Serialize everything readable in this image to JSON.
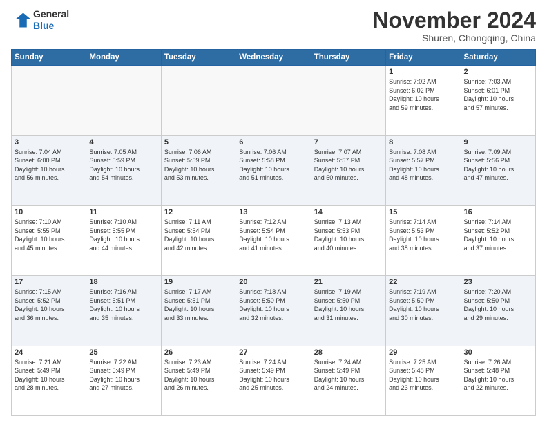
{
  "header": {
    "logo_line1": "General",
    "logo_line2": "Blue",
    "month": "November 2024",
    "location": "Shuren, Chongqing, China"
  },
  "weekdays": [
    "Sunday",
    "Monday",
    "Tuesday",
    "Wednesday",
    "Thursday",
    "Friday",
    "Saturday"
  ],
  "weeks": [
    [
      {
        "day": "",
        "info": ""
      },
      {
        "day": "",
        "info": ""
      },
      {
        "day": "",
        "info": ""
      },
      {
        "day": "",
        "info": ""
      },
      {
        "day": "",
        "info": ""
      },
      {
        "day": "1",
        "info": "Sunrise: 7:02 AM\nSunset: 6:02 PM\nDaylight: 10 hours\nand 59 minutes."
      },
      {
        "day": "2",
        "info": "Sunrise: 7:03 AM\nSunset: 6:01 PM\nDaylight: 10 hours\nand 57 minutes."
      }
    ],
    [
      {
        "day": "3",
        "info": "Sunrise: 7:04 AM\nSunset: 6:00 PM\nDaylight: 10 hours\nand 56 minutes."
      },
      {
        "day": "4",
        "info": "Sunrise: 7:05 AM\nSunset: 5:59 PM\nDaylight: 10 hours\nand 54 minutes."
      },
      {
        "day": "5",
        "info": "Sunrise: 7:06 AM\nSunset: 5:59 PM\nDaylight: 10 hours\nand 53 minutes."
      },
      {
        "day": "6",
        "info": "Sunrise: 7:06 AM\nSunset: 5:58 PM\nDaylight: 10 hours\nand 51 minutes."
      },
      {
        "day": "7",
        "info": "Sunrise: 7:07 AM\nSunset: 5:57 PM\nDaylight: 10 hours\nand 50 minutes."
      },
      {
        "day": "8",
        "info": "Sunrise: 7:08 AM\nSunset: 5:57 PM\nDaylight: 10 hours\nand 48 minutes."
      },
      {
        "day": "9",
        "info": "Sunrise: 7:09 AM\nSunset: 5:56 PM\nDaylight: 10 hours\nand 47 minutes."
      }
    ],
    [
      {
        "day": "10",
        "info": "Sunrise: 7:10 AM\nSunset: 5:55 PM\nDaylight: 10 hours\nand 45 minutes."
      },
      {
        "day": "11",
        "info": "Sunrise: 7:10 AM\nSunset: 5:55 PM\nDaylight: 10 hours\nand 44 minutes."
      },
      {
        "day": "12",
        "info": "Sunrise: 7:11 AM\nSunset: 5:54 PM\nDaylight: 10 hours\nand 42 minutes."
      },
      {
        "day": "13",
        "info": "Sunrise: 7:12 AM\nSunset: 5:54 PM\nDaylight: 10 hours\nand 41 minutes."
      },
      {
        "day": "14",
        "info": "Sunrise: 7:13 AM\nSunset: 5:53 PM\nDaylight: 10 hours\nand 40 minutes."
      },
      {
        "day": "15",
        "info": "Sunrise: 7:14 AM\nSunset: 5:53 PM\nDaylight: 10 hours\nand 38 minutes."
      },
      {
        "day": "16",
        "info": "Sunrise: 7:14 AM\nSunset: 5:52 PM\nDaylight: 10 hours\nand 37 minutes."
      }
    ],
    [
      {
        "day": "17",
        "info": "Sunrise: 7:15 AM\nSunset: 5:52 PM\nDaylight: 10 hours\nand 36 minutes."
      },
      {
        "day": "18",
        "info": "Sunrise: 7:16 AM\nSunset: 5:51 PM\nDaylight: 10 hours\nand 35 minutes."
      },
      {
        "day": "19",
        "info": "Sunrise: 7:17 AM\nSunset: 5:51 PM\nDaylight: 10 hours\nand 33 minutes."
      },
      {
        "day": "20",
        "info": "Sunrise: 7:18 AM\nSunset: 5:50 PM\nDaylight: 10 hours\nand 32 minutes."
      },
      {
        "day": "21",
        "info": "Sunrise: 7:19 AM\nSunset: 5:50 PM\nDaylight: 10 hours\nand 31 minutes."
      },
      {
        "day": "22",
        "info": "Sunrise: 7:19 AM\nSunset: 5:50 PM\nDaylight: 10 hours\nand 30 minutes."
      },
      {
        "day": "23",
        "info": "Sunrise: 7:20 AM\nSunset: 5:50 PM\nDaylight: 10 hours\nand 29 minutes."
      }
    ],
    [
      {
        "day": "24",
        "info": "Sunrise: 7:21 AM\nSunset: 5:49 PM\nDaylight: 10 hours\nand 28 minutes."
      },
      {
        "day": "25",
        "info": "Sunrise: 7:22 AM\nSunset: 5:49 PM\nDaylight: 10 hours\nand 27 minutes."
      },
      {
        "day": "26",
        "info": "Sunrise: 7:23 AM\nSunset: 5:49 PM\nDaylight: 10 hours\nand 26 minutes."
      },
      {
        "day": "27",
        "info": "Sunrise: 7:24 AM\nSunset: 5:49 PM\nDaylight: 10 hours\nand 25 minutes."
      },
      {
        "day": "28",
        "info": "Sunrise: 7:24 AM\nSunset: 5:49 PM\nDaylight: 10 hours\nand 24 minutes."
      },
      {
        "day": "29",
        "info": "Sunrise: 7:25 AM\nSunset: 5:48 PM\nDaylight: 10 hours\nand 23 minutes."
      },
      {
        "day": "30",
        "info": "Sunrise: 7:26 AM\nSunset: 5:48 PM\nDaylight: 10 hours\nand 22 minutes."
      }
    ]
  ]
}
